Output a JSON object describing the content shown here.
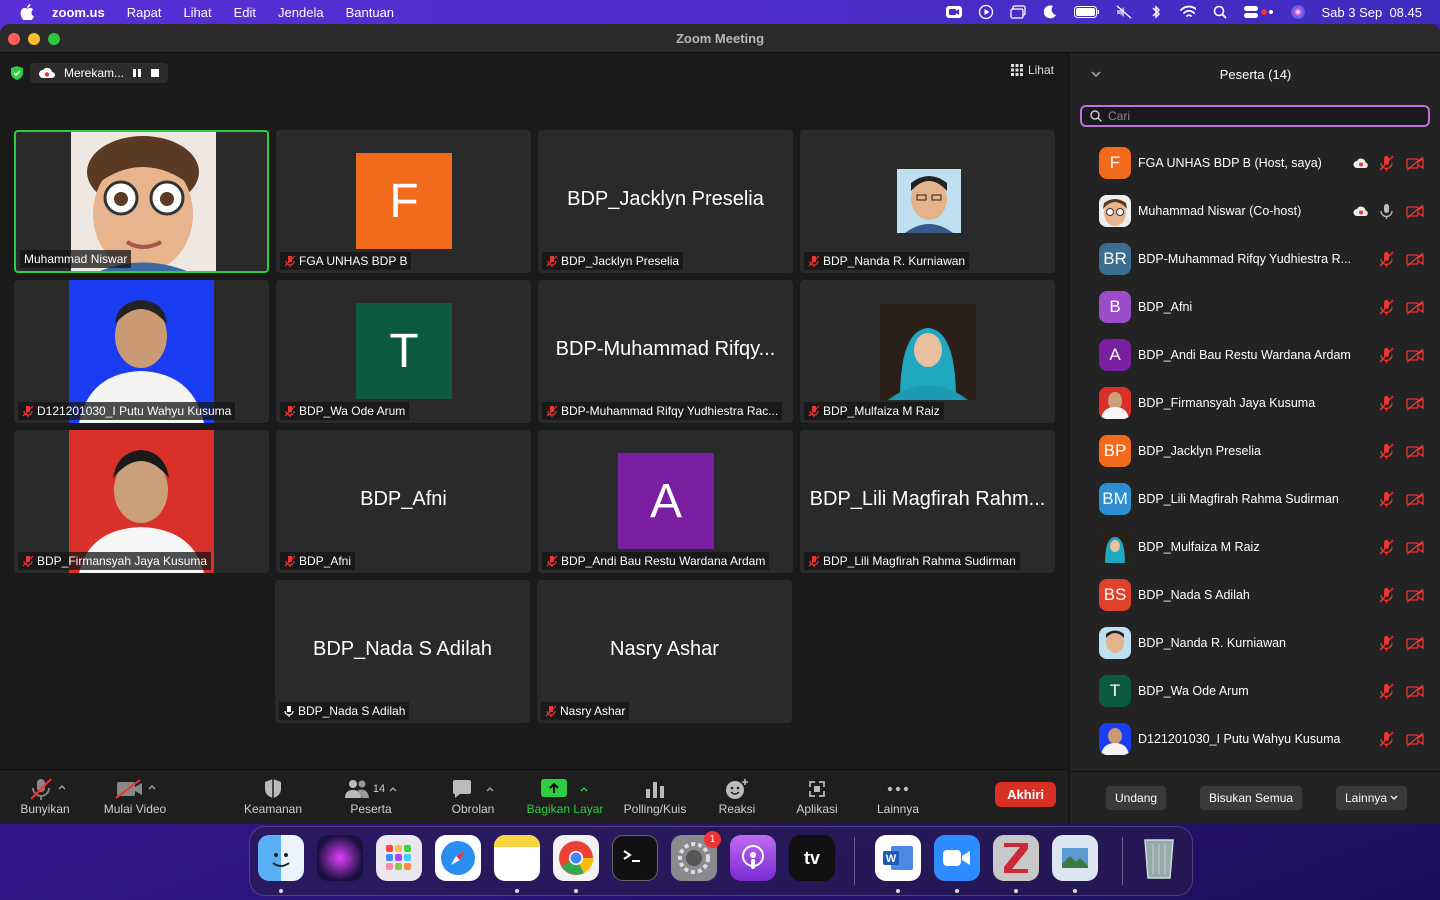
{
  "menubar": {
    "app": "zoom.us",
    "items": [
      "Rapat",
      "Lihat",
      "Edit",
      "Jendela",
      "Bantuan"
    ],
    "clock": "Sab 3 Sep  08.45"
  },
  "window": {
    "title": "Zoom Meeting"
  },
  "recording": {
    "label": "Merekam..."
  },
  "view_button": "Lihat",
  "tiles": [
    {
      "big": "",
      "name": "Muhammad Niswar",
      "avatar": "",
      "muted": false
    },
    {
      "big": "",
      "name": "FGA UNHAS BDP B",
      "avatar": "F",
      "color": "#f26b1d",
      "muted": true
    },
    {
      "big": "BDP_Jacklyn Preselia",
      "name": "BDP_Jacklyn Preselia",
      "muted": true
    },
    {
      "big": "",
      "name": "BDP_Nanda R. Kurniawan",
      "muted": true
    },
    {
      "big": "",
      "name": "D121201030_I Putu Wahyu Kusuma",
      "muted": true
    },
    {
      "big": "",
      "name": "BDP_Wa Ode Arum",
      "avatar": "T",
      "color": "#0b5a3f",
      "muted": true
    },
    {
      "big": "BDP-Muhammad Rifqy...",
      "name": "BDP-Muhammad Rifqy Yudhiestra Rac...",
      "muted": true
    },
    {
      "big": "",
      "name": "BDP_Mulfaiza M Raiz",
      "muted": true
    },
    {
      "big": "",
      "name": "BDP_Firmansyah Jaya Kusuma",
      "muted": true
    },
    {
      "big": "BDP_Afni",
      "name": "BDP_Afni",
      "muted": true
    },
    {
      "big": "",
      "name": "BDP_Andi Bau Restu Wardana Ardam",
      "avatar": "A",
      "color": "#7a1fa2",
      "muted": true
    },
    {
      "big": "BDP_Lili Magfirah Rahm...",
      "name": "BDP_Lili Magfirah Rahma Sudirman",
      "muted": true
    },
    {
      "big": "BDP_Nada S Adilah",
      "name": "BDP_Nada S Adilah",
      "muted": false
    },
    {
      "big": "Nasry Ashar",
      "name": "Nasry Ashar",
      "muted": true
    }
  ],
  "toolbar": {
    "unmute": "Bunyikan",
    "video": "Mulai Video",
    "security": "Keamanan",
    "participants": "Peserta",
    "participants_count": "14",
    "chat": "Obrolan",
    "share": "Bagikan Layar",
    "polls": "Polling/Kuis",
    "reactions": "Reaksi",
    "apps": "Aplikasi",
    "more": "Lainnya",
    "end": "Akhiri"
  },
  "panel": {
    "title": "Peserta (14)",
    "search_placeholder": "Cari",
    "participants": [
      {
        "name": "FGA UNHAS BDP B (Host, saya)",
        "initials": "F",
        "color": "#f26b1d"
      },
      {
        "name": "Muhammad Niswar (Co-host)",
        "initials": "",
        "color": "#c8a070"
      },
      {
        "name": "BDP-Muhammad Rifqy Yudhiestra R...",
        "initials": "BR",
        "color": "#3c6e8f"
      },
      {
        "name": "BDP_Afni",
        "initials": "B",
        "color": "#9b4dca"
      },
      {
        "name": "BDP_Andi Bau Restu Wardana Ardam",
        "initials": "A",
        "color": "#7a1fa2"
      },
      {
        "name": "BDP_Firmansyah Jaya Kusuma",
        "initials": "",
        "color": "#d33"
      },
      {
        "name": "BDP_Jacklyn Preselia",
        "initials": "BP",
        "color": "#f26b1d"
      },
      {
        "name": "BDP_Lili Magfirah Rahma Sudirman",
        "initials": "BM",
        "color": "#2d8fd0"
      },
      {
        "name": "BDP_Mulfaiza M Raiz",
        "initials": "",
        "color": "#1a9aa8"
      },
      {
        "name": "BDP_Nada S Adilah",
        "initials": "BS",
        "color": "#e0412d"
      },
      {
        "name": "BDP_Nanda R. Kurniawan",
        "initials": "",
        "color": "#7ab0c8"
      },
      {
        "name": "BDP_Wa Ode Arum",
        "initials": "T",
        "color": "#0b5a3f"
      },
      {
        "name": "D121201030_I Putu Wahyu Kusuma",
        "initials": "",
        "color": "#1c3cf0"
      }
    ],
    "invite": "Undang",
    "mute_all": "Bisukan Semua",
    "more": "Lainnya"
  },
  "dock": {
    "apps": [
      "finder-icon",
      "siri-icon",
      "launchpad-icon",
      "safari-icon",
      "notes-icon",
      "chrome-icon",
      "terminal-icon",
      "system-preferences-icon",
      "podcasts-icon",
      "apple-tv-icon",
      "word-icon",
      "zoom-icon",
      "zotero-icon",
      "preview-icon",
      "trash-icon"
    ],
    "settings_badge": "1",
    "tv_label": "tv"
  }
}
